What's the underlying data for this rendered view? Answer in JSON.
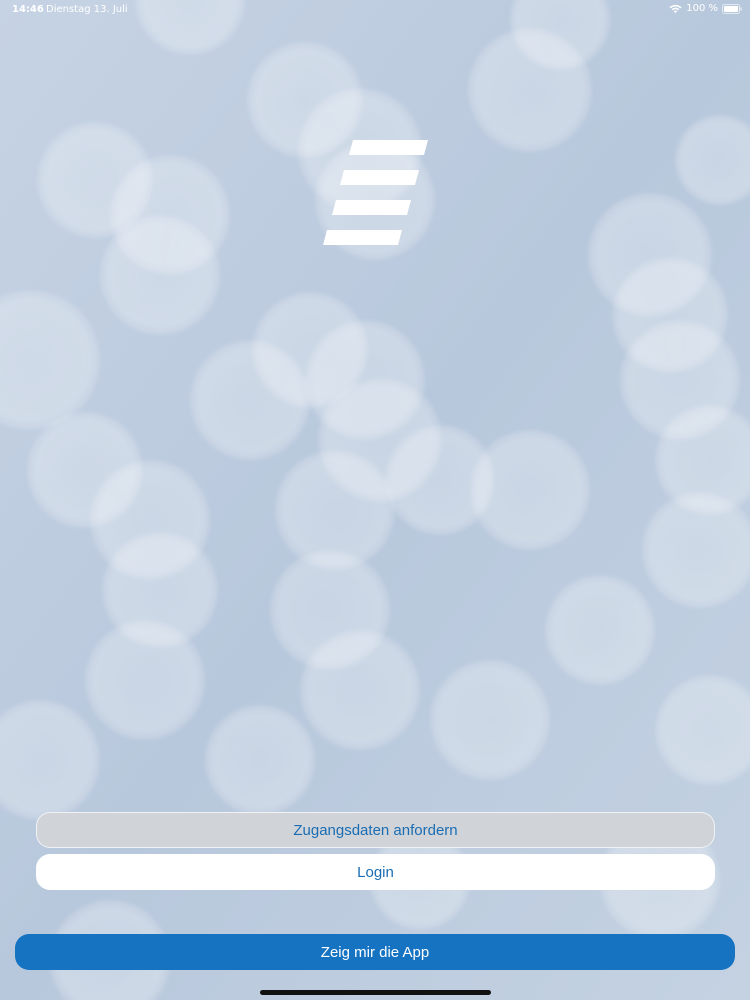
{
  "status_bar": {
    "time": "14:46",
    "date": "Dienstag 13. Juli",
    "battery": "100 %",
    "wifi_icon": "wifi-icon",
    "battery_icon": "battery-icon"
  },
  "logo": {
    "icon": "stripes-logo-icon"
  },
  "actions": {
    "request_credentials_label": "Zugangsdaten anfordern",
    "login_label": "Login",
    "demo_label": "Zeig mir die App"
  },
  "colors": {
    "accent": "#1573c2",
    "button_text": "#1a6db3",
    "secondary_button_bg": "#d0d3d8",
    "background": "#b9c8dc"
  }
}
